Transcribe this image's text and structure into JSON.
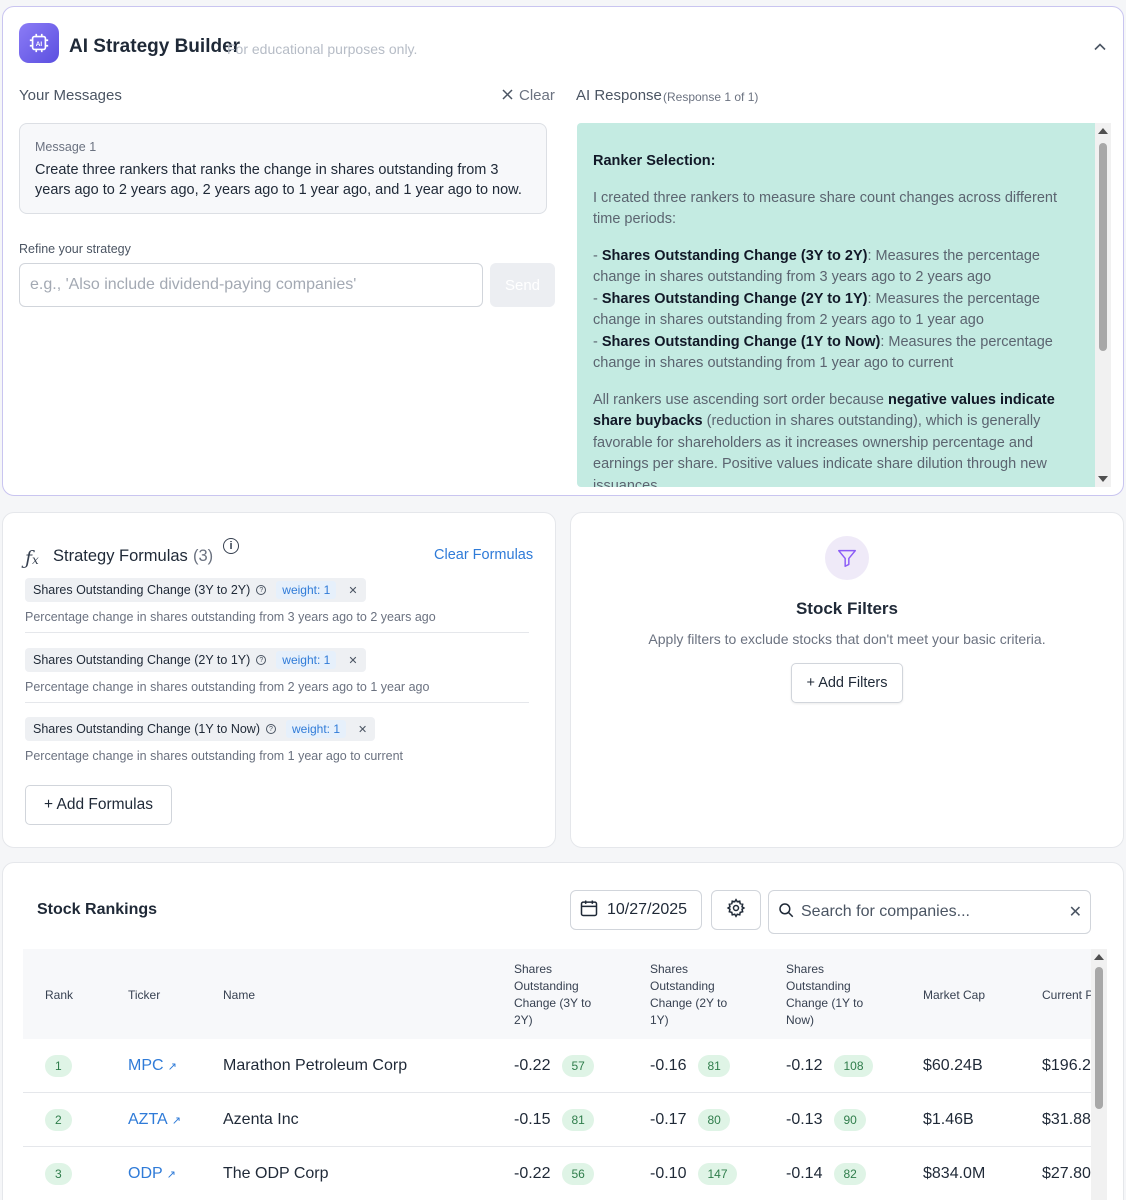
{
  "builder": {
    "title": "AI Strategy Builder",
    "subtitle": "For educational purposes only.",
    "your_messages_label": "Your Messages",
    "clear_label": "Clear",
    "ai_response_label": "AI Response",
    "response_count": "(Response 1 of 1)",
    "message": {
      "title": "Message 1",
      "text": "Create three rankers that ranks the change in shares outstanding from 3 years ago to 2 years ago, 2 years ago to 1 year ago, and 1 year ago to now."
    },
    "refine_label": "Refine your strategy",
    "refine_placeholder": "e.g., 'Also include dividend-paying companies'",
    "send_label": "Send",
    "response": {
      "heading": "Ranker Selection:",
      "intro": "I created three rankers to measure share count changes across different time periods:",
      "items": [
        {
          "name": "Shares Outstanding Change (3Y to 2Y)",
          "desc": ": Measures the percentage change in shares outstanding from 3 years ago to 2 years ago"
        },
        {
          "name": "Shares Outstanding Change (2Y to 1Y)",
          "desc": ": Measures the percentage change in shares outstanding from 2 years ago to 1 year ago"
        },
        {
          "name": "Shares Outstanding Change (1Y to Now)",
          "desc": ": Measures the percentage change in shares outstanding from 1 year ago to current"
        }
      ],
      "para_before_bold": "All rankers use ascending sort order because ",
      "para_bold": "negative values indicate share buybacks",
      "para_after_bold": " (reduction in shares outstanding), which is generally favorable for shareholders as it increases ownership percentage and earnings per share. Positive values indicate share dilution through new issuances."
    }
  },
  "formulas": {
    "title": "Strategy Formulas",
    "count": "(3)",
    "clear_label": "Clear Formulas",
    "items": [
      {
        "name": "Shares Outstanding Change (3Y to 2Y)",
        "weight": "weight: 1",
        "desc": "Percentage change in shares outstanding from 3 years ago to 2 years ago"
      },
      {
        "name": "Shares Outstanding Change (2Y to 1Y)",
        "weight": "weight: 1",
        "desc": "Percentage change in shares outstanding from 2 years ago to 1 year ago"
      },
      {
        "name": "Shares Outstanding Change (1Y to Now)",
        "weight": "weight: 1",
        "desc": "Percentage change in shares outstanding from 1 year ago to current"
      }
    ],
    "add_label": "+ Add Formulas"
  },
  "filters": {
    "title": "Stock Filters",
    "subtitle": "Apply filters to exclude stocks that don't meet your basic criteria.",
    "add_label": "+ Add Filters"
  },
  "rankings": {
    "title": "Stock Rankings",
    "date": "10/27/2025",
    "search_placeholder": "Search for companies...",
    "columns": {
      "rank": "Rank",
      "ticker": "Ticker",
      "name": "Name",
      "c1": "Shares Outstanding Change (3Y to 2Y)",
      "c2": "Shares Outstanding Change (2Y to 1Y)",
      "c3": "Shares Outstanding Change (1Y to Now)",
      "mcap": "Market Cap",
      "price": "Current P"
    },
    "rows": [
      {
        "rank": "1",
        "ticker": "MPC",
        "name": "Marathon Petroleum Corp",
        "v1": "-0.22",
        "r1": "57",
        "v2": "-0.16",
        "r2": "81",
        "v3": "-0.12",
        "r3": "108",
        "mcap": "$60.24B",
        "price": "$196.2"
      },
      {
        "rank": "2",
        "ticker": "AZTA",
        "name": "Azenta Inc",
        "v1": "-0.15",
        "r1": "81",
        "v2": "-0.17",
        "r2": "80",
        "v3": "-0.13",
        "r3": "90",
        "mcap": "$1.46B",
        "price": "$31.88"
      },
      {
        "rank": "3",
        "ticker": "ODP",
        "name": "The ODP Corp",
        "v1": "-0.22",
        "r1": "56",
        "v2": "-0.10",
        "r2": "147",
        "v3": "-0.14",
        "r3": "82",
        "mcap": "$834.0M",
        "price": "$27.80"
      }
    ]
  }
}
